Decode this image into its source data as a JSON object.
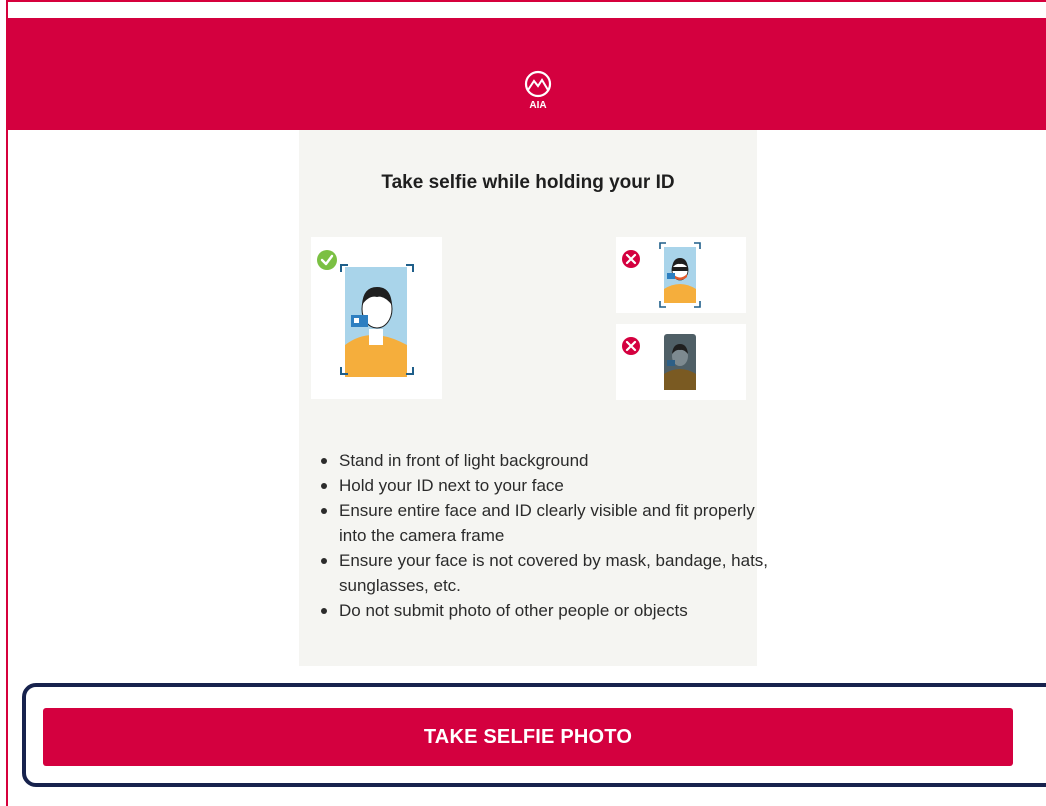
{
  "brand": {
    "logo_text": "AIA",
    "primary_color": "#d4003f",
    "outline_color": "#17224d"
  },
  "card": {
    "title": "Take selfie while holding your ID",
    "examples": [
      {
        "status": "good",
        "icon": "check-icon",
        "label": ""
      },
      {
        "status": "bad",
        "icon": "cross-icon",
        "label": ""
      },
      {
        "status": "bad",
        "icon": "cross-icon",
        "label": ""
      }
    ],
    "rules": [
      "Stand in front of light background",
      "Hold your ID next to your face",
      "Ensure entire face and ID clearly visible and fit properly into the camera frame",
      "Ensure your face is not covered by mask, bandage, hats, sunglasses, etc.",
      "Do not submit photo of other people or objects"
    ]
  },
  "actions": {
    "take_selfie_label": "TAKE SELFIE PHOTO"
  }
}
